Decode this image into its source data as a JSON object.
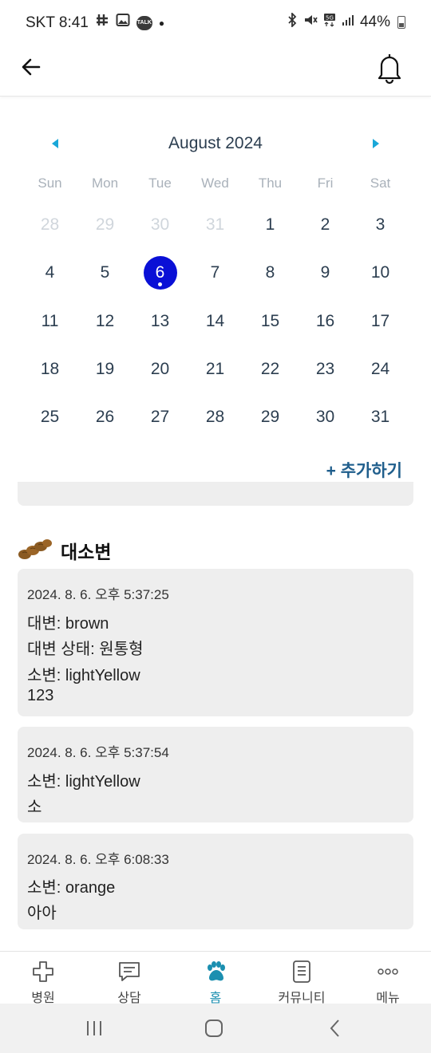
{
  "status_bar": {
    "carrier_time": "SKT 8:41",
    "notification_icons": [
      "hash-icon",
      "image-icon",
      "kakaotalk-icon",
      "dot"
    ],
    "talk_label": "TALK",
    "battery": "44%",
    "system_icons": [
      "bluetooth-icon",
      "mute-icon",
      "5g-icon",
      "signal-icon",
      "battery-icon"
    ]
  },
  "header": {
    "back_icon": "arrow-left-icon",
    "notification_icon": "bell-icon"
  },
  "calendar": {
    "title": "August 2024",
    "weekdays": [
      "Sun",
      "Mon",
      "Tue",
      "Wed",
      "Thu",
      "Fri",
      "Sat"
    ],
    "days": [
      {
        "label": "28",
        "muted": true
      },
      {
        "label": "29",
        "muted": true
      },
      {
        "label": "30",
        "muted": true
      },
      {
        "label": "31",
        "muted": true
      },
      {
        "label": "1"
      },
      {
        "label": "2"
      },
      {
        "label": "3"
      },
      {
        "label": "4"
      },
      {
        "label": "5"
      },
      {
        "label": "6",
        "selected": true,
        "has_event": true
      },
      {
        "label": "7"
      },
      {
        "label": "8"
      },
      {
        "label": "9"
      },
      {
        "label": "10"
      },
      {
        "label": "11"
      },
      {
        "label": "12"
      },
      {
        "label": "13"
      },
      {
        "label": "14"
      },
      {
        "label": "15"
      },
      {
        "label": "16"
      },
      {
        "label": "17"
      },
      {
        "label": "18"
      },
      {
        "label": "19"
      },
      {
        "label": "20"
      },
      {
        "label": "21"
      },
      {
        "label": "22"
      },
      {
        "label": "23"
      },
      {
        "label": "24"
      },
      {
        "label": "25"
      },
      {
        "label": "26"
      },
      {
        "label": "27"
      },
      {
        "label": "28"
      },
      {
        "label": "29"
      },
      {
        "label": "30"
      },
      {
        "label": "31"
      }
    ],
    "add_label": "+ 추가하기",
    "selected_color": "#0a10d6",
    "arrow_color": "#1aa7d8"
  },
  "section": {
    "title": "대소변",
    "icon": "poop-icon"
  },
  "records": [
    {
      "time": "2024. 8. 6. 오후 5:37:25",
      "lines": [
        "대변: brown",
        "대변 상태: 원통형",
        "소변: lightYellow",
        "123"
      ]
    },
    {
      "time": "2024. 8. 6. 오후 5:37:54",
      "lines": [
        "소변: lightYellow",
        "소"
      ]
    },
    {
      "time": "2024. 8. 6. 오후 6:08:33",
      "lines": [
        "소변: orange",
        "아아"
      ]
    }
  ],
  "bottom_nav": {
    "items": [
      {
        "label": "병원",
        "icon": "hospital-cross-icon"
      },
      {
        "label": "상담",
        "icon": "chat-icon"
      },
      {
        "label": "홈",
        "icon": "paw-icon",
        "active": true
      },
      {
        "label": "커뮤니티",
        "icon": "document-icon"
      },
      {
        "label": "메뉴",
        "icon": "more-icon"
      }
    ],
    "active_color": "#1b8fb0"
  },
  "system_nav": {
    "icons": [
      "recent-apps-icon",
      "home-icon",
      "back-icon"
    ]
  }
}
